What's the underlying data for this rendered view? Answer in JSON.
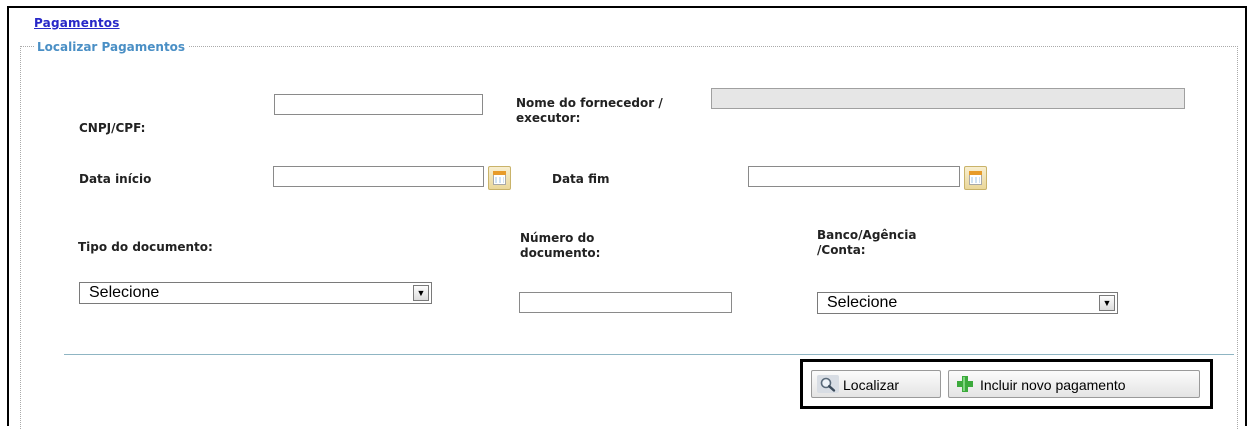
{
  "breadcrumb": "Pagamentos",
  "form": {
    "legend": "Localizar Pagamentos",
    "cnpj_label": "CNPJ/CPF:",
    "cnpj_value": "",
    "fornecedor_label": "Nome do fornecedor / executor:",
    "fornecedor_value": "",
    "data_inicio_label": "Data início",
    "data_inicio_value": "",
    "data_fim_label": "Data fim",
    "data_fim_value": "",
    "tipo_label": "Tipo do documento:",
    "tipo_selected": "Selecione",
    "numero_label": "Número do documento:",
    "numero_value": "",
    "banco_label": "Banco/Agência /Conta:",
    "banco_selected": "Selecione"
  },
  "actions": {
    "localizar_label": "Localizar",
    "incluir_label": "Incluir novo pagamento"
  },
  "icons": {
    "calendar": "calendar-icon",
    "search": "magnifier-icon",
    "add": "green-plus-icon",
    "dropdown": "chevron-down-icon"
  },
  "colors": {
    "link": "#2828c8",
    "legend": "#4a8fc5",
    "add_icon": "#3caa3c"
  }
}
